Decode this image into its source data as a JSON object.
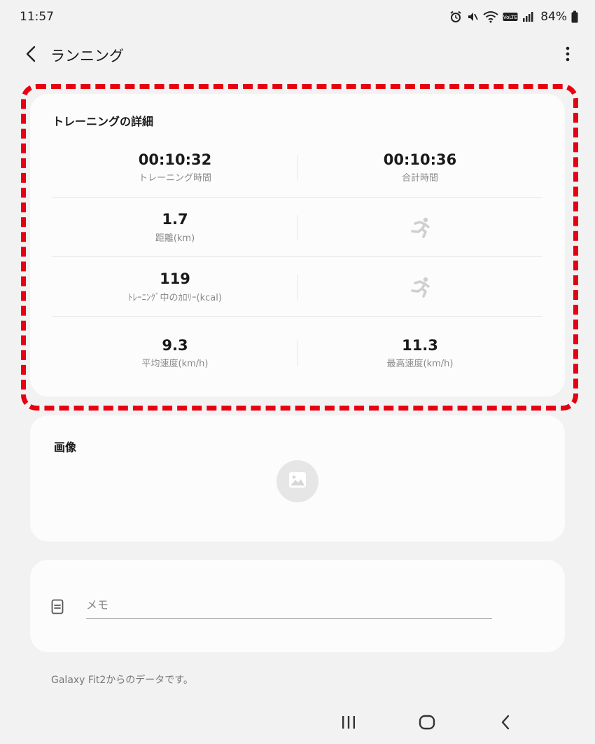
{
  "status_bar": {
    "time": "11:57",
    "battery": "84%",
    "icons": [
      "alarm-icon",
      "mute-icon",
      "wifi-icon",
      "volte-icon",
      "signal-icon",
      "battery-icon"
    ]
  },
  "app_bar": {
    "title": "ランニング",
    "back_icon": "chevron-left-icon",
    "more_icon": "more-vertical-icon"
  },
  "details": {
    "title": "トレーニングの詳細",
    "rows": [
      {
        "left": {
          "value": "00:10:32",
          "label": "トレーニング時間"
        },
        "right": {
          "value": "00:10:36",
          "label": "合計時間"
        }
      },
      {
        "left": {
          "value": "1.7",
          "label": "距離(km)"
        },
        "right": {
          "icon": "running-person-icon"
        }
      },
      {
        "left": {
          "value": "119",
          "label": "ﾄﾚｰﾆﾝｸﾞ中のｶﾛﾘｰ(kcal)"
        },
        "right": {
          "icon": "running-person-icon"
        }
      },
      {
        "left": {
          "value": "9.3",
          "label": "平均速度(km/h)"
        },
        "right": {
          "value": "11.3",
          "label": "最高速度(km/h)"
        }
      }
    ]
  },
  "image_section": {
    "title": "画像",
    "add_icon": "image-icon"
  },
  "memo": {
    "placeholder": "メモ",
    "value": "",
    "icon": "note-icon"
  },
  "source_note": "Galaxy Fit2からのデータです。",
  "colors": {
    "highlight": "#e60012",
    "background": "#f2f2f2",
    "card": "#fcfcfc"
  },
  "nav_bar": {
    "icons": [
      "recent-apps-icon",
      "home-icon",
      "back-icon"
    ]
  }
}
